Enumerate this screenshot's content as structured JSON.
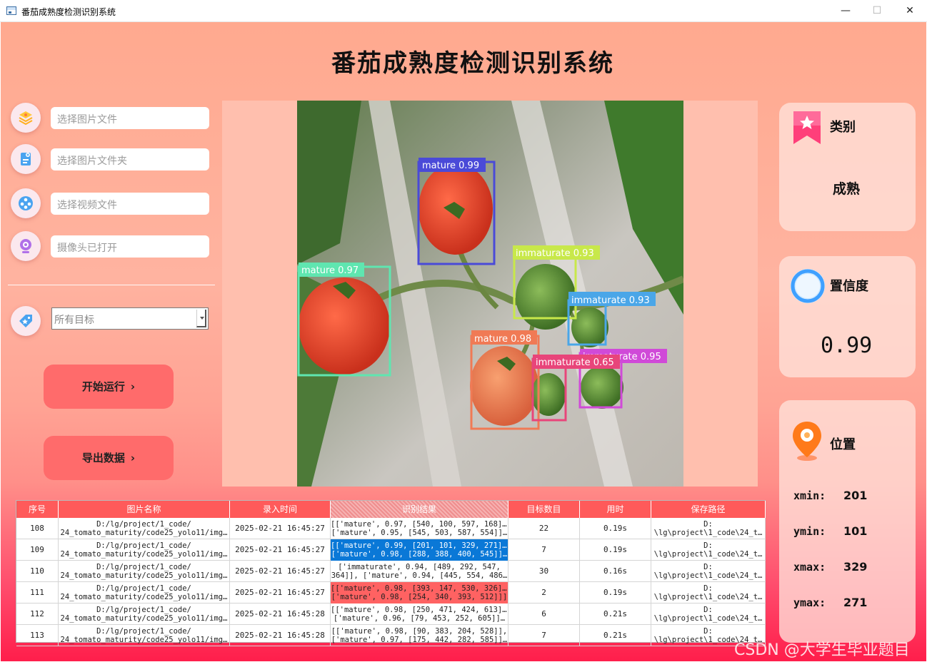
{
  "window": {
    "title": "番茄成熟度检测识别系统",
    "controls": {
      "minimize": "—",
      "maximize": "☐",
      "close": "✕"
    }
  },
  "app_title": "番茄成熟度检测识别系统",
  "left_panel": {
    "inputs": [
      {
        "placeholder": "选择图片文件",
        "icon": "image-file-icon"
      },
      {
        "placeholder": "选择图片文件夹",
        "icon": "folder-icon"
      },
      {
        "placeholder": "选择视频文件",
        "icon": "video-icon"
      },
      {
        "placeholder": "摄像头已打开",
        "icon": "camera-icon"
      }
    ],
    "target_select": {
      "value": "所有目标",
      "icon": "tag-icon"
    },
    "run_button": "开始运行",
    "export_button": "导出数据",
    "chevron": "›"
  },
  "detections": [
    {
      "label": "mature 0.99",
      "color": "#4a4ad8"
    },
    {
      "label": "mature 0.97",
      "color": "#5fe6b0"
    },
    {
      "label": "immaturate 0.93",
      "color": "#c8e84a"
    },
    {
      "label": "immaturate 0.93",
      "color": "#4aa6e8"
    },
    {
      "label": "mature 0.98",
      "color": "#f07a55"
    },
    {
      "label": "immaturate 0.65",
      "color": "#e8457a"
    },
    {
      "label": "immaturate 0.95",
      "color": "#d04ad8"
    }
  ],
  "right_panel": {
    "category": {
      "label": "类别",
      "value": "成熟",
      "icon": "bookmark-star-icon"
    },
    "confidence": {
      "label": "置信度",
      "value": "0.99",
      "icon": "ring-icon"
    },
    "position": {
      "label": "位置",
      "icon": "location-pin-icon",
      "xmin_label": "xmin:",
      "xmin": "201",
      "ymin_label": "ymin:",
      "ymin": "101",
      "xmax_label": "xmax:",
      "xmax": "329",
      "ymax_label": "ymax:",
      "ymax": "271"
    }
  },
  "table": {
    "columns": [
      "序号",
      "图片名称",
      "录入时间",
      "识别结果",
      "目标数目",
      "用时",
      "保存路径"
    ],
    "rows": [
      {
        "id": "108",
        "name1": "D:/lg/project/1_code/",
        "name2": "24_tomato_maturity/code25_yolo11/img…",
        "time": "2025-02-21 16:45:27",
        "res1": "[['mature', 0.97, [540, 100, 597, 168]],",
        "res2": "['mature', 0.95, [545, 503, 587, 554]]…",
        "count": "22",
        "elapsed": "0.19s",
        "path1": "D:",
        "path2": "\\lg\\project\\1_code\\24_t…",
        "hl": ""
      },
      {
        "id": "109",
        "name1": "D:/lg/project/1_code/",
        "name2": "24_tomato_maturity/code25_yolo11/img…",
        "time": "2025-02-21 16:45:27",
        "res1": "[['mature', 0.99, [201, 101, 329, 271]],",
        "res2": "['mature', 0.98, [288, 388, 400, 545]]…",
        "count": "7",
        "elapsed": "0.19s",
        "path1": "D:",
        "path2": "\\lg\\project\\1_code\\24_t…",
        "hl": "blue"
      },
      {
        "id": "110",
        "name1": "D:/lg/project/1_code/",
        "name2": "24_tomato_maturity/code25_yolo11/img…",
        "time": "2025-02-21 16:45:27",
        "res1": "['immaturate', 0.94, [489, 292, 547,",
        "res2": "364]], ['mature', 0.94, [445, 554, 486…",
        "count": "30",
        "elapsed": "0.16s",
        "path1": "D:",
        "path2": "\\lg\\project\\1_code\\24_t…",
        "hl": ""
      },
      {
        "id": "111",
        "name1": "D:/lg/project/1_code/",
        "name2": "24_tomato_maturity/code25_yolo11/img…",
        "time": "2025-02-21 16:45:27",
        "res1": "[['mature', 0.98, [393, 147, 530, 326]],",
        "res2": "['mature', 0.98, [254, 340, 393, 512]]]",
        "count": "2",
        "elapsed": "0.19s",
        "path1": "D:",
        "path2": "\\lg\\project\\1_code\\24_t…",
        "hl": "red"
      },
      {
        "id": "112",
        "name1": "D:/lg/project/1_code/",
        "name2": "24_tomato_maturity/code25_yolo11/img…",
        "time": "2025-02-21 16:45:28",
        "res1": "[['mature', 0.98, [250, 471, 424, 613]],",
        "res2": "['mature', 0.96, [79, 453, 252, 605]]…",
        "count": "6",
        "elapsed": "0.21s",
        "path1": "D:",
        "path2": "\\lg\\project\\1_code\\24_t…",
        "hl": ""
      },
      {
        "id": "113",
        "name1": "D:/lg/project/1_code/",
        "name2": "24_tomato_maturity/code25_yolo11/img…",
        "time": "2025-02-21 16:45:28",
        "res1": "[['mature', 0.98, [90, 383, 204, 528]],",
        "res2": "['mature', 0.97, [175, 442, 282, 585]]…",
        "count": "7",
        "elapsed": "0.21s",
        "path1": "D:",
        "path2": "\\lg\\project\\1_code\\24_t…",
        "hl": ""
      }
    ]
  },
  "watermark": "CSDN @大学生毕业题目"
}
